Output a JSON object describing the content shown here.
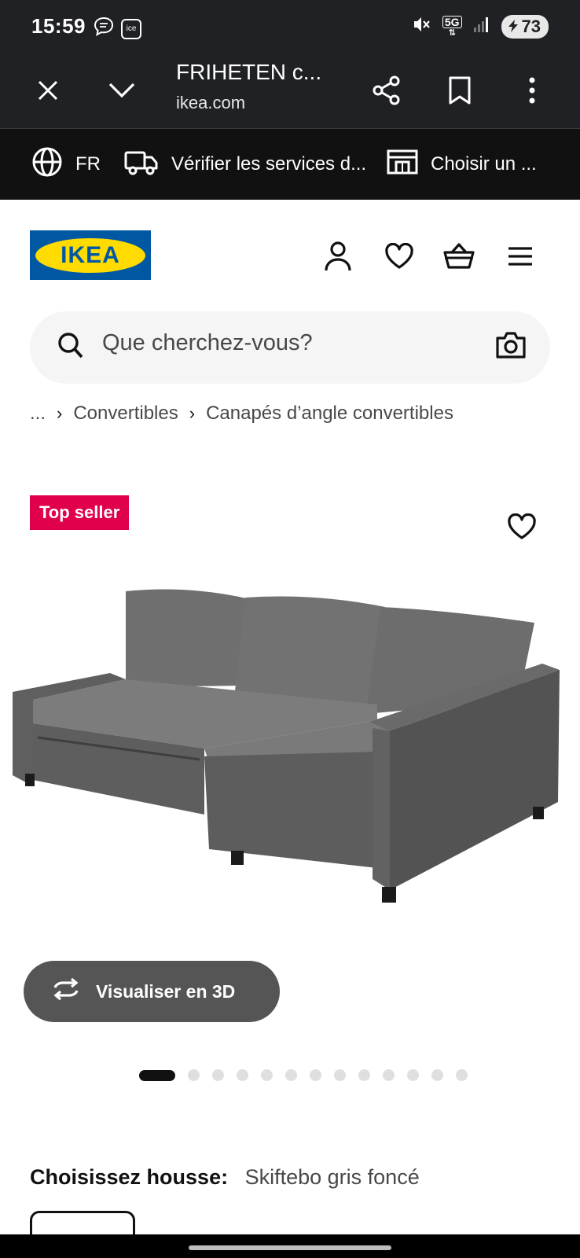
{
  "status_bar": {
    "time": "15:59",
    "left_icons": [
      "chat-bubble-icon",
      "ice-badge-icon"
    ],
    "ice_label": "ice",
    "right_icons": [
      "mute-vibrate-icon",
      "5g-icon",
      "signal-icon"
    ],
    "network": "5G",
    "battery": "73"
  },
  "tab_bar": {
    "title": "FRIHETEN c...",
    "url": "ikea.com"
  },
  "top_strip": {
    "language": "FR",
    "services": "Vérifier les services d...",
    "store": "Choisir un ..."
  },
  "header": {
    "logo_text": "IKEA",
    "brand_colors": {
      "blue": "#0058a3",
      "yellow": "#ffdb00"
    }
  },
  "search": {
    "placeholder": "Que cherchez-vous?"
  },
  "breadcrumb": {
    "ellipsis": "...",
    "items": [
      "Convertibles",
      "Canapés d’angle convertibles"
    ]
  },
  "product": {
    "badge": "Top seller",
    "badge_color": "#e0004b",
    "visualize_3d": "Visualiser en 3D",
    "gallery": {
      "total_images": 13,
      "active_index": 0
    },
    "choose_label": "Choisissez housse:",
    "choose_value": "Skiftebo gris foncé"
  }
}
